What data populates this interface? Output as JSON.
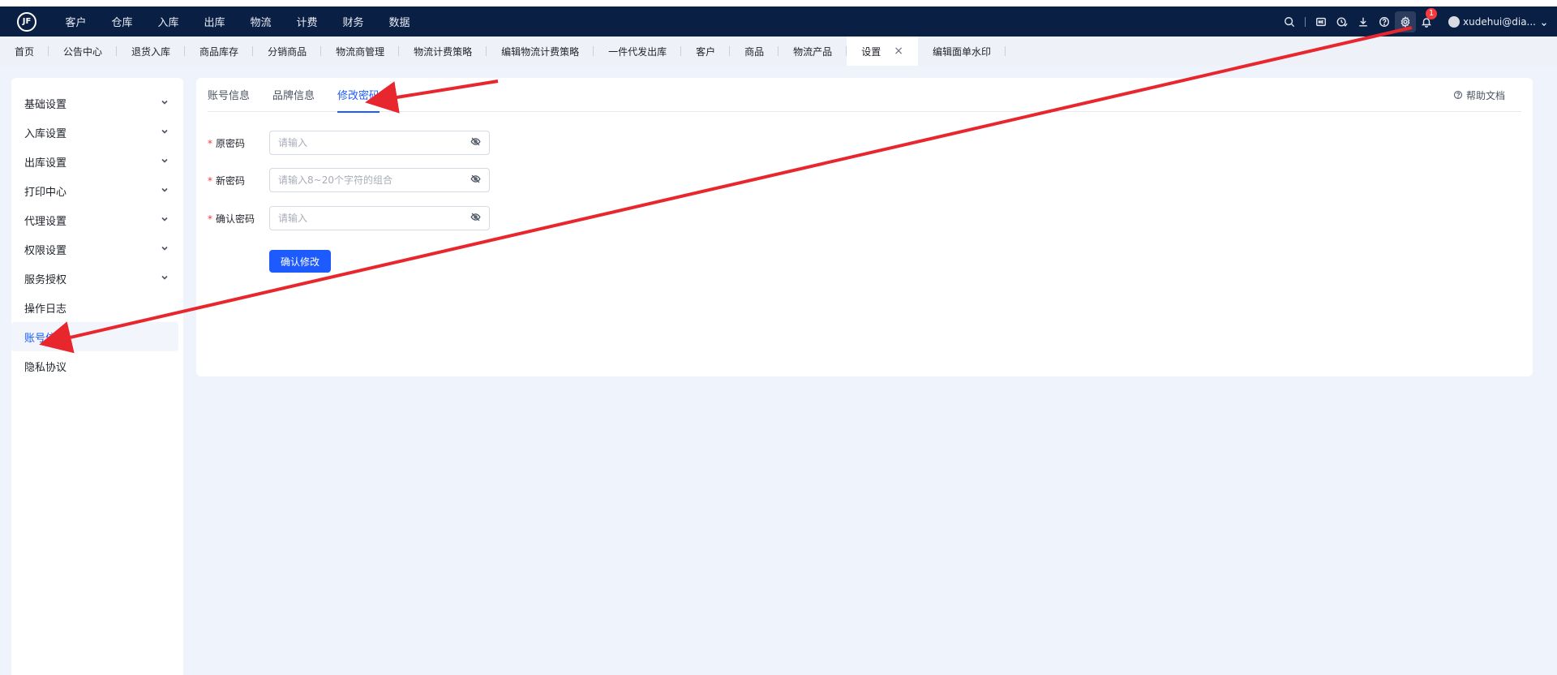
{
  "topnav": {
    "logo_text": "JF",
    "items": [
      "客户",
      "仓库",
      "入库",
      "出库",
      "物流",
      "计费",
      "财务",
      "数据"
    ],
    "notification_count": "1",
    "user_label": "xudehui@dia..."
  },
  "tabs": {
    "items": [
      "首页",
      "公告中心",
      "退货入库",
      "商品库存",
      "分销商品",
      "物流商管理",
      "物流计费策略",
      "编辑物流计费策略",
      "一件代发出库",
      "客户",
      "商品",
      "物流产品",
      "设置",
      "编辑面单水印"
    ],
    "active": "设置",
    "close_glyph": "×"
  },
  "sidebar": {
    "items": [
      {
        "label": "基础设置",
        "expandable": true
      },
      {
        "label": "入库设置",
        "expandable": true
      },
      {
        "label": "出库设置",
        "expandable": true
      },
      {
        "label": "打印中心",
        "expandable": true
      },
      {
        "label": "代理设置",
        "expandable": true
      },
      {
        "label": "权限设置",
        "expandable": true
      },
      {
        "label": "服务授权",
        "expandable": true
      },
      {
        "label": "操作日志",
        "expandable": false
      },
      {
        "label": "账号信息",
        "expandable": false
      },
      {
        "label": "隐私协议",
        "expandable": false
      }
    ],
    "active": "账号信息"
  },
  "main": {
    "subtabs": [
      "账号信息",
      "品牌信息",
      "修改密码"
    ],
    "active_subtab": "修改密码",
    "help_label": "帮助文档",
    "form": {
      "old_password": {
        "label": "原密码",
        "placeholder": "请输入",
        "value": ""
      },
      "new_password": {
        "label": "新密码",
        "placeholder": "请输入8~20个字符的组合",
        "value": ""
      },
      "confirm_password": {
        "label": "确认密码",
        "placeholder": "请输入",
        "value": ""
      },
      "required_mark": "*",
      "submit_label": "确认修改"
    }
  },
  "colors": {
    "topnav_bg": "#0a1f44",
    "accent": "#1e5bff",
    "page_bg": "#eff3fb",
    "annotation_arrow": "#e8262d"
  }
}
